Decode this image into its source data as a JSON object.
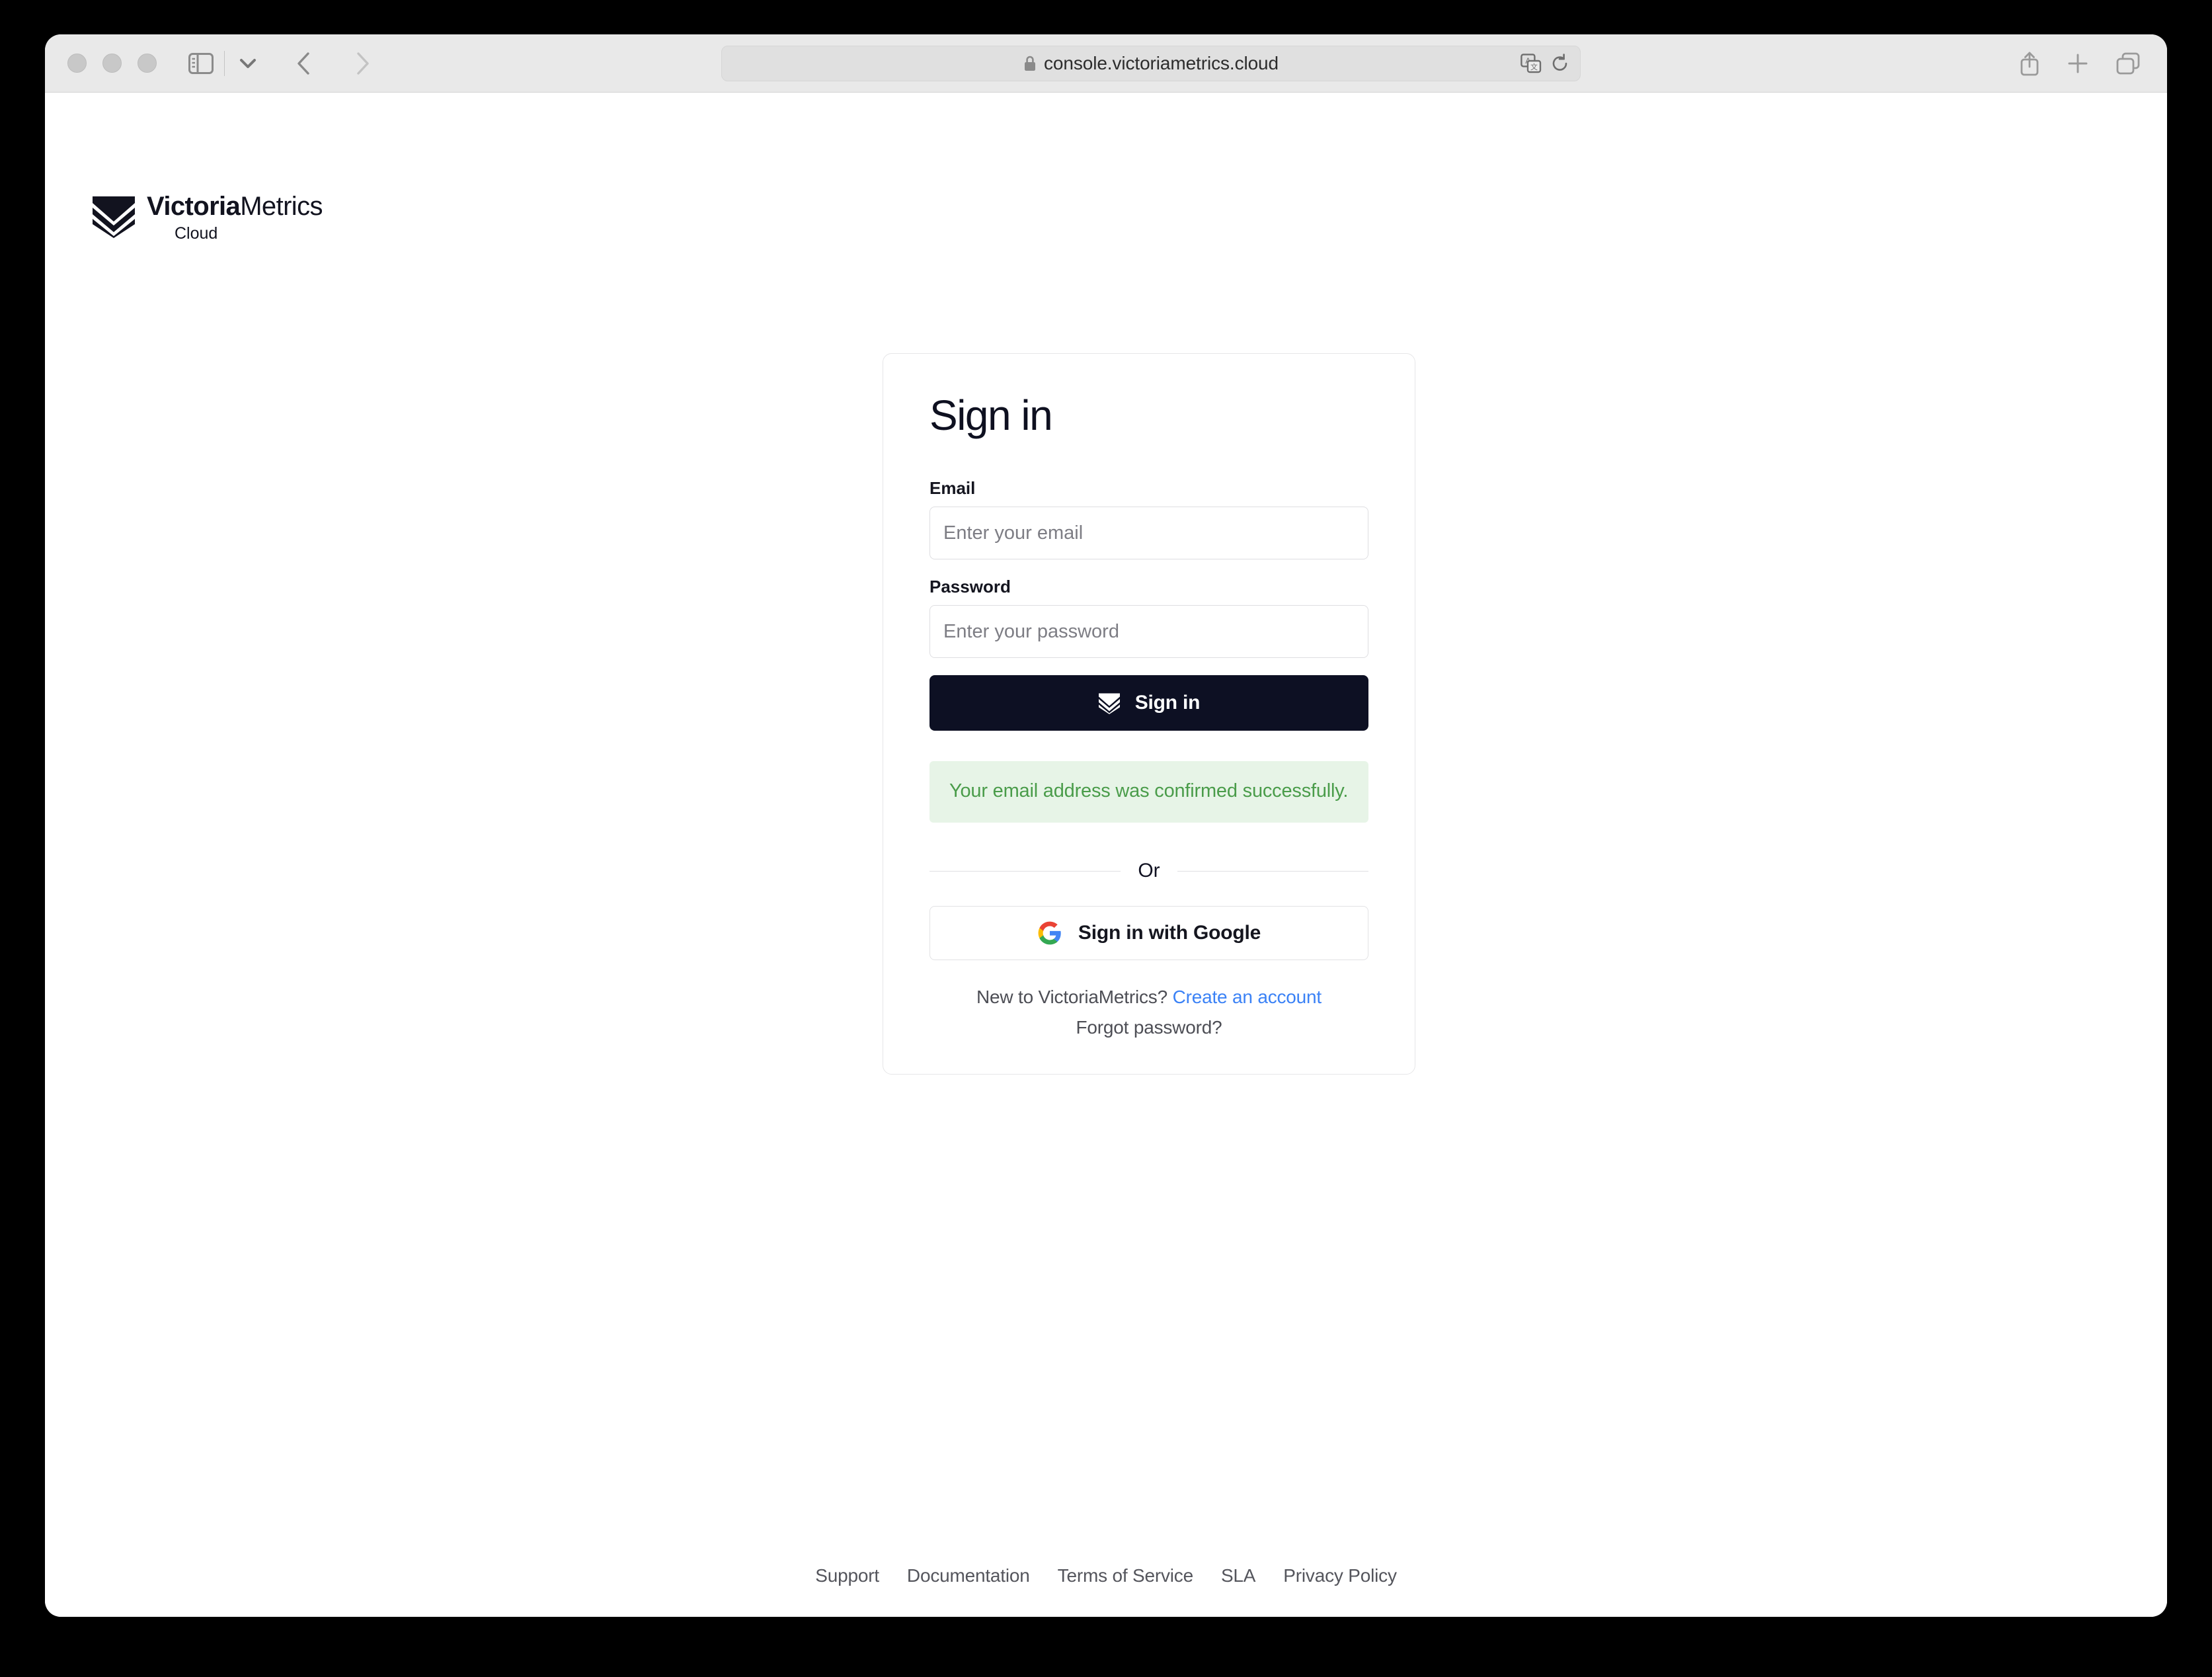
{
  "browser": {
    "url": "console.victoriametrics.cloud",
    "icons": {
      "lock": "lock-icon",
      "sidebar_toggle": "sidebar-toggle-icon",
      "tab_group_chevron": "chevron-down-icon",
      "back": "back-arrow-icon",
      "forward": "forward-arrow-icon",
      "translate": "translate-icon",
      "reload": "reload-icon",
      "share": "share-icon",
      "new_tab": "plus-icon",
      "tab_overview": "tab-overview-icon"
    }
  },
  "brand": {
    "name_bold": "Victoria",
    "name_light": "Metrics",
    "subtitle": "Cloud",
    "logo_icon": "victoriametrics-chevrons-logo"
  },
  "signin": {
    "title": "Sign in",
    "email": {
      "label": "Email",
      "placeholder": "Enter your email",
      "value": ""
    },
    "password": {
      "label": "Password",
      "placeholder": "Enter your password",
      "value": ""
    },
    "submit_label": "Sign in",
    "submit_icon": "victoriametrics-chevrons-logo",
    "alert": {
      "text": "Your email address was confirmed successfully.",
      "type": "success",
      "text_color": "#4a9c4a",
      "background_color": "#e7f4e7"
    },
    "divider_label": "Or",
    "google_button": {
      "label": "Sign in with Google",
      "icon": "google-g-icon"
    },
    "footer": {
      "new_user_text": "New to VictoriaMetrics?",
      "create_account_link": "Create an account",
      "forgot_password_link": "Forgot password?"
    }
  },
  "footer_links": [
    {
      "label": "Support"
    },
    {
      "label": "Documentation"
    },
    {
      "label": "Terms of Service"
    },
    {
      "label": "SLA"
    },
    {
      "label": "Privacy Policy"
    }
  ],
  "colors": {
    "brand_dark": "#0d1023",
    "link_blue": "#3b82f6",
    "success_green": "#4a9c4a",
    "success_bg": "#e7f4e7"
  }
}
